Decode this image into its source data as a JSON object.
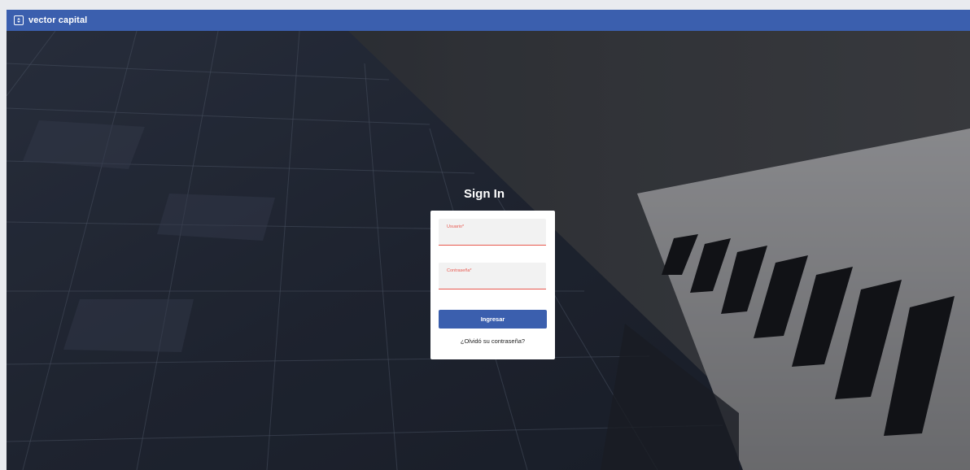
{
  "header": {
    "brand": "vector capital",
    "logo_icon": "vector-logo-icon",
    "color": "#3b5fae"
  },
  "login": {
    "title": "Sign In",
    "username_label": "Usuario*",
    "username_value": "",
    "password_label": "Contraseña*",
    "password_value": "",
    "submit_label": "Ingresar",
    "forgot_label": "¿Olvidó su contraseña?",
    "field_accent": "#e8584f",
    "button_color": "#3b5fae"
  },
  "background": {
    "image": "glass-building-photo"
  }
}
